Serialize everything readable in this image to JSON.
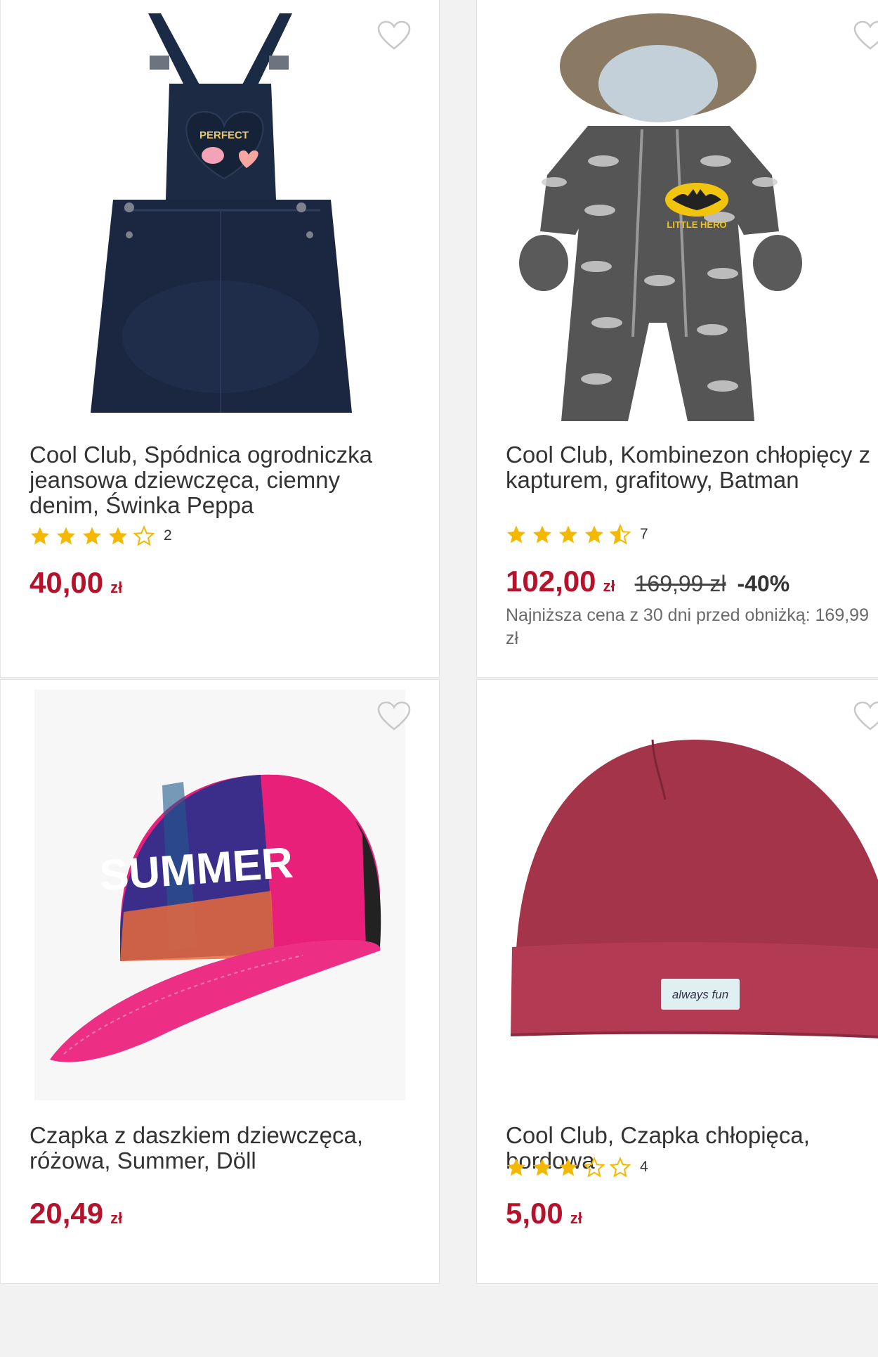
{
  "products": [
    {
      "title": "Cool Club, Spódnica ogrodniczka jeansowa dziewczęca, ciemny denim, Świnka Peppa",
      "rating": 4,
      "rating_count": "2",
      "price": "40,00",
      "currency": "zł",
      "image_label": "PERFECT"
    },
    {
      "title": "Cool Club, Kombinezon chłopięcy z kapturem, grafitowy, Batman",
      "rating": 4.5,
      "rating_count": "7",
      "price": "102,00",
      "currency": "zł",
      "old_price": "169,99 zł",
      "discount": "-40%",
      "lowest_price_note": "Najniższa cena z 30 dni przed obniżką: 169,99 zł",
      "image_label": "LITTLE HERO"
    },
    {
      "title": "Czapka z daszkiem dziewczęca, różowa, Summer, Döll",
      "price": "20,49",
      "currency": "zł",
      "image_label": "SUMMER"
    },
    {
      "title": "Cool Club, Czapka chłopięca, bordowa",
      "rating": 3,
      "rating_count": "4",
      "price": "5,00",
      "currency": "zł",
      "image_label": "always fun"
    }
  ],
  "colors": {
    "price": "#b5122b",
    "star": "#f5b800",
    "heart_outline": "#c8c8c8"
  },
  "icons": {
    "favorite": "heart-outline-icon",
    "rating_full": "star-filled-icon",
    "rating_half": "star-half-icon",
    "rating_empty": "star-outline-icon"
  }
}
